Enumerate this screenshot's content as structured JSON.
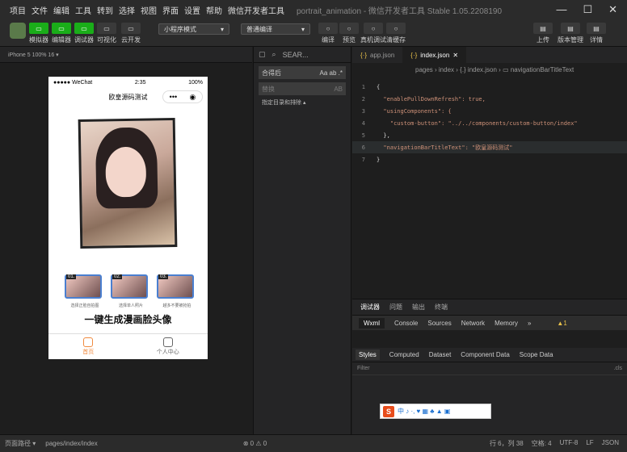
{
  "menubar": {
    "items": [
      "项目",
      "文件",
      "编辑",
      "工具",
      "转到",
      "选择",
      "视图",
      "界面",
      "设置",
      "帮助",
      "微信开发者工具"
    ],
    "title": "portrait_animation - 微信开发者工具 Stable 1.05.2208190"
  },
  "toolbar": {
    "left_buttons": [
      {
        "label": "模拟器",
        "icon": "phone-icon"
      },
      {
        "label": "编辑器",
        "icon": "code-icon"
      },
      {
        "label": "调试器",
        "icon": "bug-icon"
      },
      {
        "label": "可视化",
        "icon": "layout-icon"
      },
      {
        "label": "云开发",
        "icon": "cloud-icon"
      }
    ],
    "mode_select": "小程序模式",
    "compile_select": "普通编译",
    "mid_buttons": [
      {
        "label": "编译",
        "icon": "refresh-icon"
      },
      {
        "label": "预览",
        "icon": "eye-icon"
      },
      {
        "label": "真机调试",
        "icon": "bug-icon"
      },
      {
        "label": "清缓存",
        "icon": "layers-icon"
      }
    ],
    "right_buttons": [
      {
        "label": "上传",
        "icon": "upload-icon"
      },
      {
        "label": "版本管理",
        "icon": "branch-icon"
      },
      {
        "label": "详情",
        "icon": "menu-icon"
      }
    ]
  },
  "simulator": {
    "device": "iPhone 5 100% 16 ▾",
    "status_left": "●●●●● WeChat",
    "status_time": "2:35",
    "status_right": "100%",
    "nav_title": "欧皇源码测试",
    "capsule_more": "•••",
    "thumb_tags": [
      "01.",
      "02.",
      "03."
    ],
    "thumb_captions": [
      "选择正脸自拍图",
      "选择单人照片",
      "越多不要被抢拍"
    ],
    "headline": "一键生成漫画脸头像",
    "tabs": [
      {
        "label": "首页",
        "active": true
      },
      {
        "label": "个人中心",
        "active": false
      }
    ]
  },
  "explorer": {
    "search_label": "SEAR...",
    "search_value": "合得后",
    "replace_placeholder": "替换",
    "link": "指定目录和排除 ▴"
  },
  "editor": {
    "tabs": [
      {
        "label": "app.json",
        "active": false
      },
      {
        "label": "index.json",
        "active": true
      }
    ],
    "breadcrumb": "pages › index › {.} index.json › ▭ navigationBarTitleText",
    "lines": [
      {
        "n": "1",
        "text": "{"
      },
      {
        "n": "2",
        "text": "  \"enablePullDownRefresh\": true,"
      },
      {
        "n": "3",
        "text": "  \"usingComponents\": {"
      },
      {
        "n": "4",
        "text": "    \"custom-button\": \"../../components/custom-button/index\""
      },
      {
        "n": "5",
        "text": "  },"
      },
      {
        "n": "6",
        "text": "  \"navigationBarTitleText\": \"欧皇源码测试\""
      },
      {
        "n": "7",
        "text": "}"
      }
    ]
  },
  "devtools": {
    "top_tabs": [
      "调试器",
      "问题",
      "输出",
      "终端"
    ],
    "panel_tabs": [
      "Wxml",
      "Console",
      "Sources",
      "Network",
      "Memory",
      "»"
    ],
    "warning_count": "▲1",
    "sub_tabs": [
      "Styles",
      "Computed",
      "Dataset",
      "Component Data",
      "Scope Data"
    ],
    "filter_placeholder": "Filter",
    "cls": ".cls"
  },
  "ime": {
    "logo": "S",
    "items": "中 ♪ ·, ♥ ▦ ♣ ▲ ▣"
  },
  "statusbar": {
    "path_label": "页面路径 ▾",
    "path": "pages/index/index",
    "problems": "⊗ 0 ⚠ 0",
    "position": "行 6，列 38",
    "spaces": "空格: 4",
    "encoding": "UTF-8",
    "eol": "LF",
    "lang": "JSON"
  }
}
